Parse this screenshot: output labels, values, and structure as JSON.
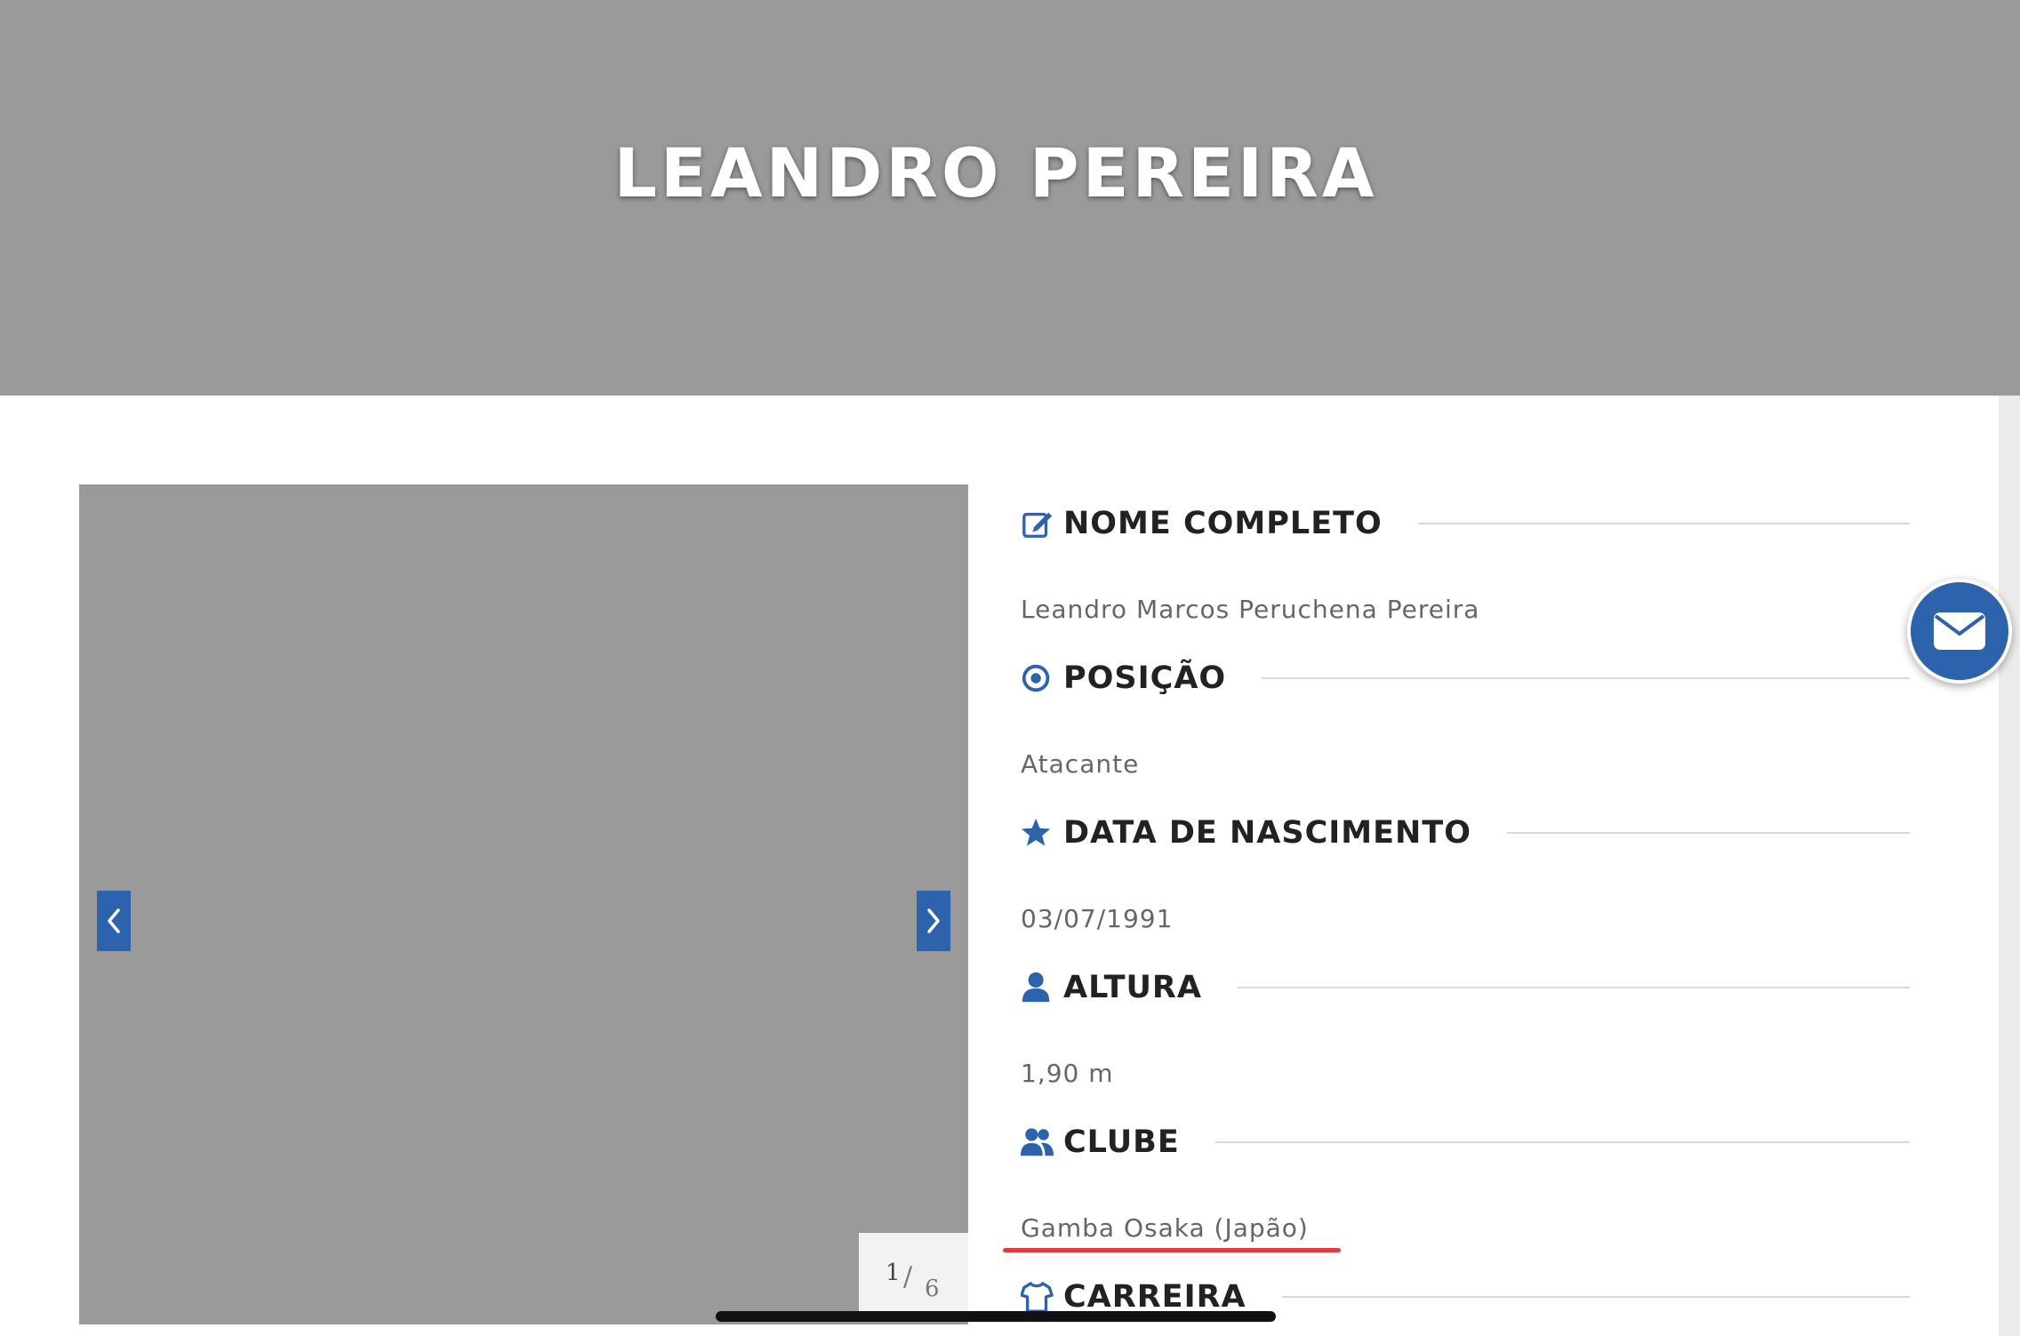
{
  "hero": {
    "title": "LEANDRO PEREIRA"
  },
  "carousel": {
    "current": "1",
    "separator": "/",
    "total": "6"
  },
  "details": {
    "full_name": {
      "label": "NOME COMPLETO",
      "value": "Leandro Marcos Peruchena Pereira",
      "icon": "edit-icon"
    },
    "position": {
      "label": "POSIÇÃO",
      "value": "Atacante",
      "icon": "target-icon"
    },
    "birth_date": {
      "label": "DATA DE NASCIMENTO",
      "value": "03/07/1991",
      "icon": "star-icon"
    },
    "height": {
      "label": "ALTURA",
      "value": "1,90 m",
      "icon": "user-icon"
    },
    "club": {
      "label": "CLUBE",
      "value": "Gamba Osaka (Japão)",
      "icon": "users-icon"
    },
    "career": {
      "label": "CARREIRA",
      "icon": "shirt-icon"
    }
  },
  "colors": {
    "accent": "#2d62ad",
    "annotation_underline": "#e23b3b"
  }
}
